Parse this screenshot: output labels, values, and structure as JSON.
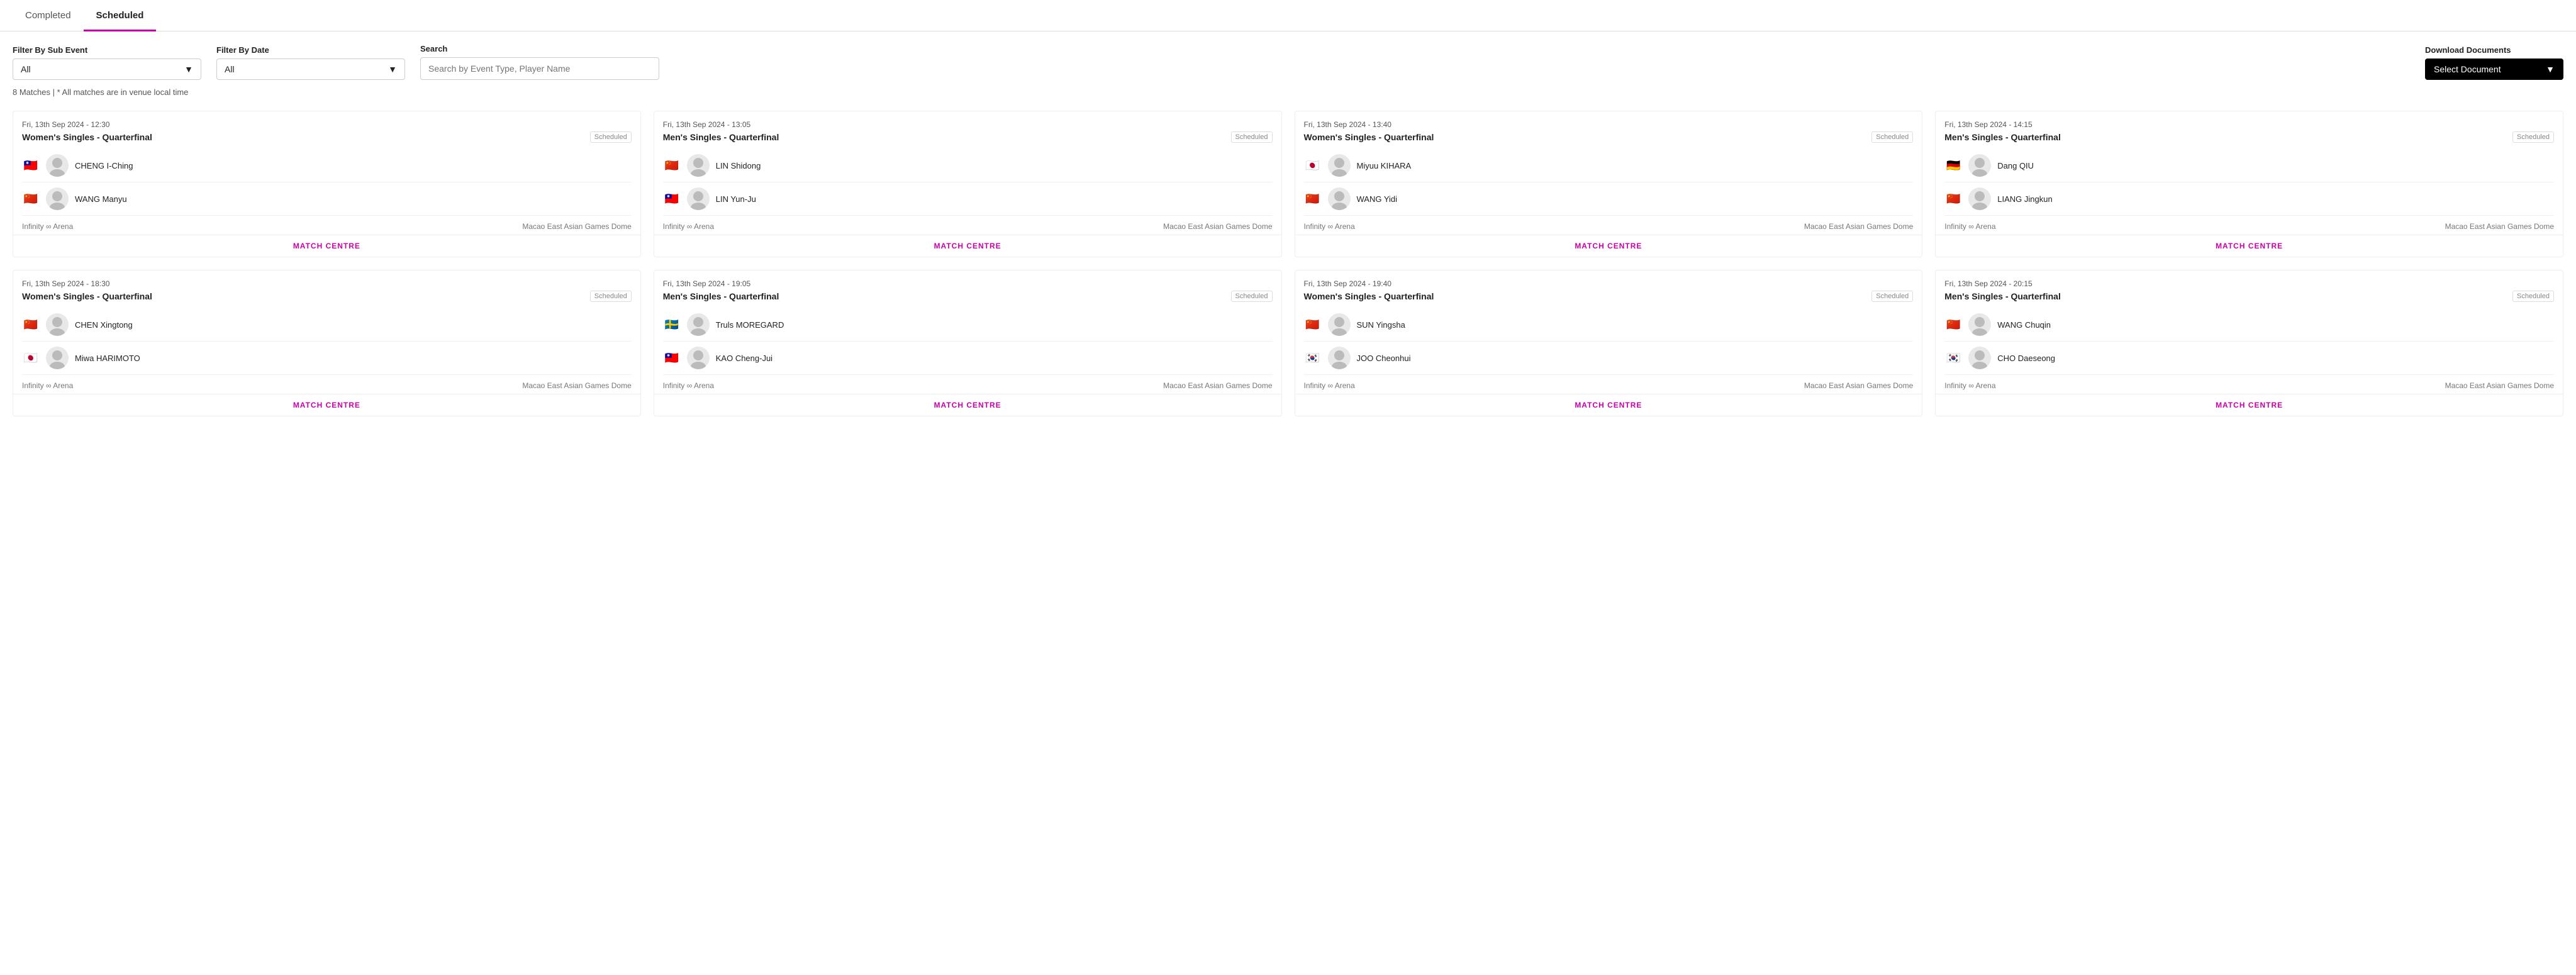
{
  "tabs": [
    {
      "id": "completed",
      "label": "Completed",
      "active": false
    },
    {
      "id": "scheduled",
      "label": "Scheduled",
      "active": true
    }
  ],
  "filters": {
    "sub_event_label": "Filter By Sub Event",
    "sub_event_value": "All",
    "date_label": "Filter By Date",
    "date_value": "All",
    "search_label": "Search",
    "search_placeholder": "Search by Event Type, Player Name",
    "download_label": "Download Documents",
    "download_btn": "Select Document"
  },
  "match_info": "8 Matches  |  * All matches are in venue local time",
  "matches": [
    {
      "datetime": "Fri, 13th Sep 2024 - 12:30",
      "title": "Women's Singles - Quarterfinal",
      "status": "Scheduled",
      "players": [
        {
          "flag": "🇹🇼",
          "name": "CHENG I-Ching"
        },
        {
          "flag": "🇨🇳",
          "name": "WANG Manyu"
        }
      ],
      "venue1": "Infinity ∞ Arena",
      "venue2": "Macao East Asian Games Dome",
      "match_centre": "MATCH CENTRE"
    },
    {
      "datetime": "Fri, 13th Sep 2024 - 13:05",
      "title": "Men's Singles - Quarterfinal",
      "status": "Scheduled",
      "players": [
        {
          "flag": "🇨🇳",
          "name": "LIN Shidong"
        },
        {
          "flag": "🇹🇼",
          "name": "LIN Yun-Ju"
        }
      ],
      "venue1": "Infinity ∞ Arena",
      "venue2": "Macao East Asian Games Dome",
      "match_centre": "MATCH CENTRE"
    },
    {
      "datetime": "Fri, 13th Sep 2024 - 13:40",
      "title": "Women's Singles - Quarterfinal",
      "status": "Scheduled",
      "players": [
        {
          "flag": "🇯🇵",
          "name": "Miyuu KIHARA"
        },
        {
          "flag": "🇨🇳",
          "name": "WANG Yidi"
        }
      ],
      "venue1": "Infinity ∞ Arena",
      "venue2": "Macao East Asian Games Dome",
      "match_centre": "MATCH CENTRE"
    },
    {
      "datetime": "Fri, 13th Sep 2024 - 14:15",
      "title": "Men's Singles - Quarterfinal",
      "status": "Scheduled",
      "players": [
        {
          "flag": "🇩🇪",
          "name": "Dang QIU"
        },
        {
          "flag": "🇨🇳",
          "name": "LIANG Jingkun"
        }
      ],
      "venue1": "Infinity ∞ Arena",
      "venue2": "Macao East Asian Games Dome",
      "match_centre": "MATCH CENTRE"
    },
    {
      "datetime": "Fri, 13th Sep 2024 - 18:30",
      "title": "Women's Singles - Quarterfinal",
      "status": "Scheduled",
      "players": [
        {
          "flag": "🇨🇳",
          "name": "CHEN Xingtong"
        },
        {
          "flag": "🇯🇵",
          "name": "Miwa HARIMOTO"
        }
      ],
      "venue1": "Infinity ∞ Arena",
      "venue2": "Macao East Asian Games Dome",
      "match_centre": "MATCH CENTRE"
    },
    {
      "datetime": "Fri, 13th Sep 2024 - 19:05",
      "title": "Men's Singles - Quarterfinal",
      "status": "Scheduled",
      "players": [
        {
          "flag": "🇸🇪",
          "name": "Truls MOREGARD"
        },
        {
          "flag": "🇹🇼",
          "name": "KAO Cheng-Jui"
        }
      ],
      "venue1": "Infinity ∞ Arena",
      "venue2": "Macao East Asian Games Dome",
      "match_centre": "MATCH CENTRE"
    },
    {
      "datetime": "Fri, 13th Sep 2024 - 19:40",
      "title": "Women's Singles - Quarterfinal",
      "status": "Scheduled",
      "players": [
        {
          "flag": "🇨🇳",
          "name": "SUN Yingsha"
        },
        {
          "flag": "🇰🇷",
          "name": "JOO Cheonhui"
        }
      ],
      "venue1": "Infinity ∞ Arena",
      "venue2": "Macao East Asian Games Dome",
      "match_centre": "MATCH CENTRE"
    },
    {
      "datetime": "Fri, 13th Sep 2024 - 20:15",
      "title": "Men's Singles - Quarterfinal",
      "status": "Scheduled",
      "players": [
        {
          "flag": "🇨🇳",
          "name": "WANG Chuqin"
        },
        {
          "flag": "🇰🇷",
          "name": "CHO Daeseong"
        }
      ],
      "venue1": "Infinity ∞ Arena",
      "venue2": "Macao East Asian Games Dome",
      "match_centre": "MATCH CENTRE"
    }
  ]
}
